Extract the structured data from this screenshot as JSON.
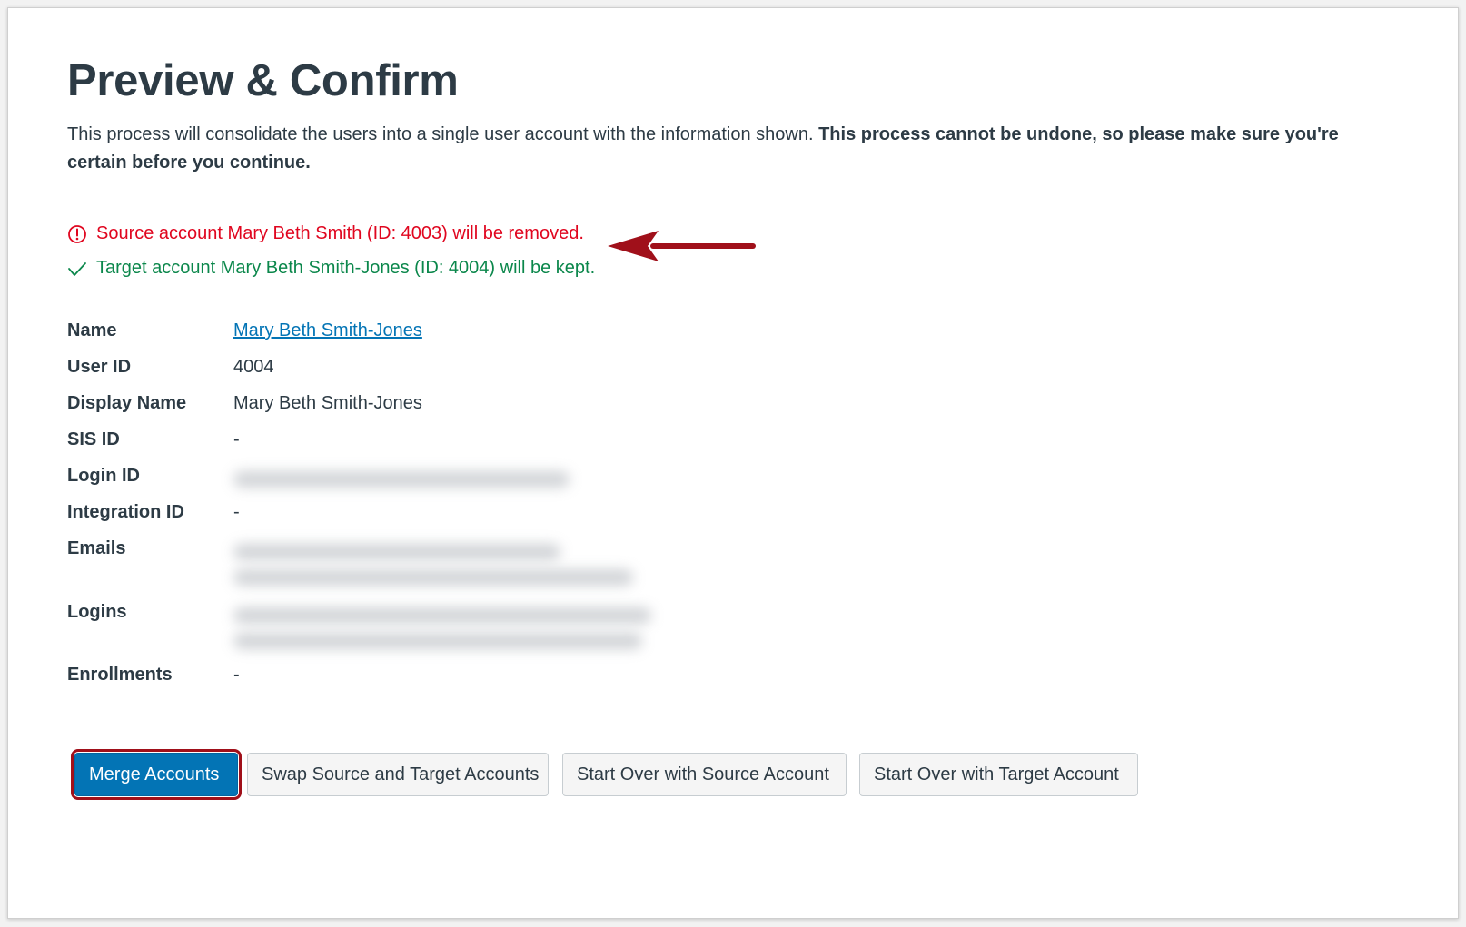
{
  "page": {
    "title": "Preview & Confirm",
    "intro_text": "This process will consolidate the users into a single user account with the information shown. ",
    "intro_bold": "This process cannot be undone, so please make sure you're certain before you continue."
  },
  "alerts": {
    "removed": {
      "text": "Source account Mary Beth Smith (ID: 4003) will be removed.",
      "icon": "warning-circle-icon",
      "color": "#e0061f"
    },
    "kept": {
      "text": "Target account Mary Beth Smith-Jones (ID: 4004) will be kept.",
      "icon": "checkmark-icon",
      "color": "#0b874b"
    }
  },
  "details": {
    "name_label": "Name",
    "name_value": "Mary Beth Smith-Jones",
    "user_id_label": "User ID",
    "user_id_value": "4004",
    "display_name_label": "Display Name",
    "display_name_value": "Mary Beth Smith-Jones",
    "sis_id_label": "SIS ID",
    "sis_id_value": "-",
    "login_id_label": "Login ID",
    "integration_id_label": "Integration ID",
    "integration_id_value": "-",
    "emails_label": "Emails",
    "logins_label": "Logins",
    "enrollments_label": "Enrollments",
    "enrollments_value": "-"
  },
  "buttons": {
    "merge": "Merge Accounts",
    "swap": "Swap Source and Target Accounts",
    "start_over_source": "Start Over with Source Account",
    "start_over_target": "Start Over with Target Account"
  },
  "colors": {
    "primary": "#0374b5",
    "annotation_arrow": "#a0101a"
  }
}
